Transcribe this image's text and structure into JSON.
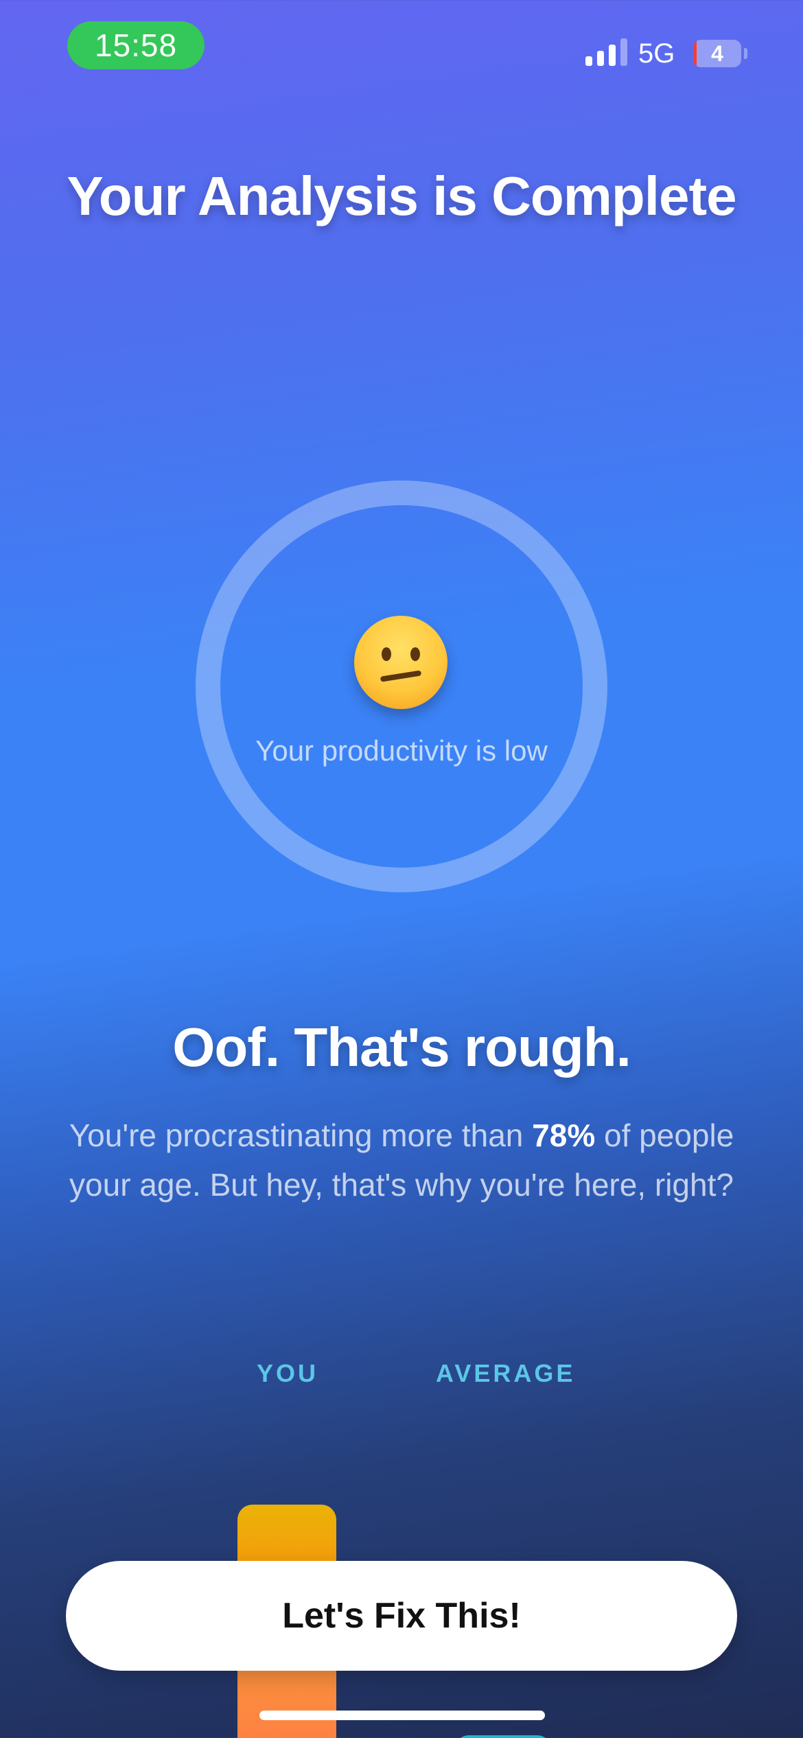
{
  "status_bar": {
    "time": "15:58",
    "network": "5G",
    "battery": "4"
  },
  "title": "Your Analysis is Complete",
  "score": {
    "emoji_icon": "confused-face-icon",
    "caption": "Your productivity is low"
  },
  "result": {
    "headline": "Oof. That's rough.",
    "body_prefix": "You're procrastinating more than ",
    "highlight": "78%",
    "body_suffix": " of people your age. But hey, that's why you're here, right?"
  },
  "comparison": {
    "you_label": "YOU",
    "average_label": "AVERAGE"
  },
  "cta": {
    "label": "Let's Fix This!"
  },
  "colors": {
    "gradient_top": "#6366F1",
    "gradient_mid": "#3B82F6",
    "gradient_bottom": "#1F2C55",
    "time_pill": "#34C759",
    "you_bar": "#F59E0B",
    "average_bar": "#22B8CF",
    "label_accent": "#5CC6E6"
  }
}
